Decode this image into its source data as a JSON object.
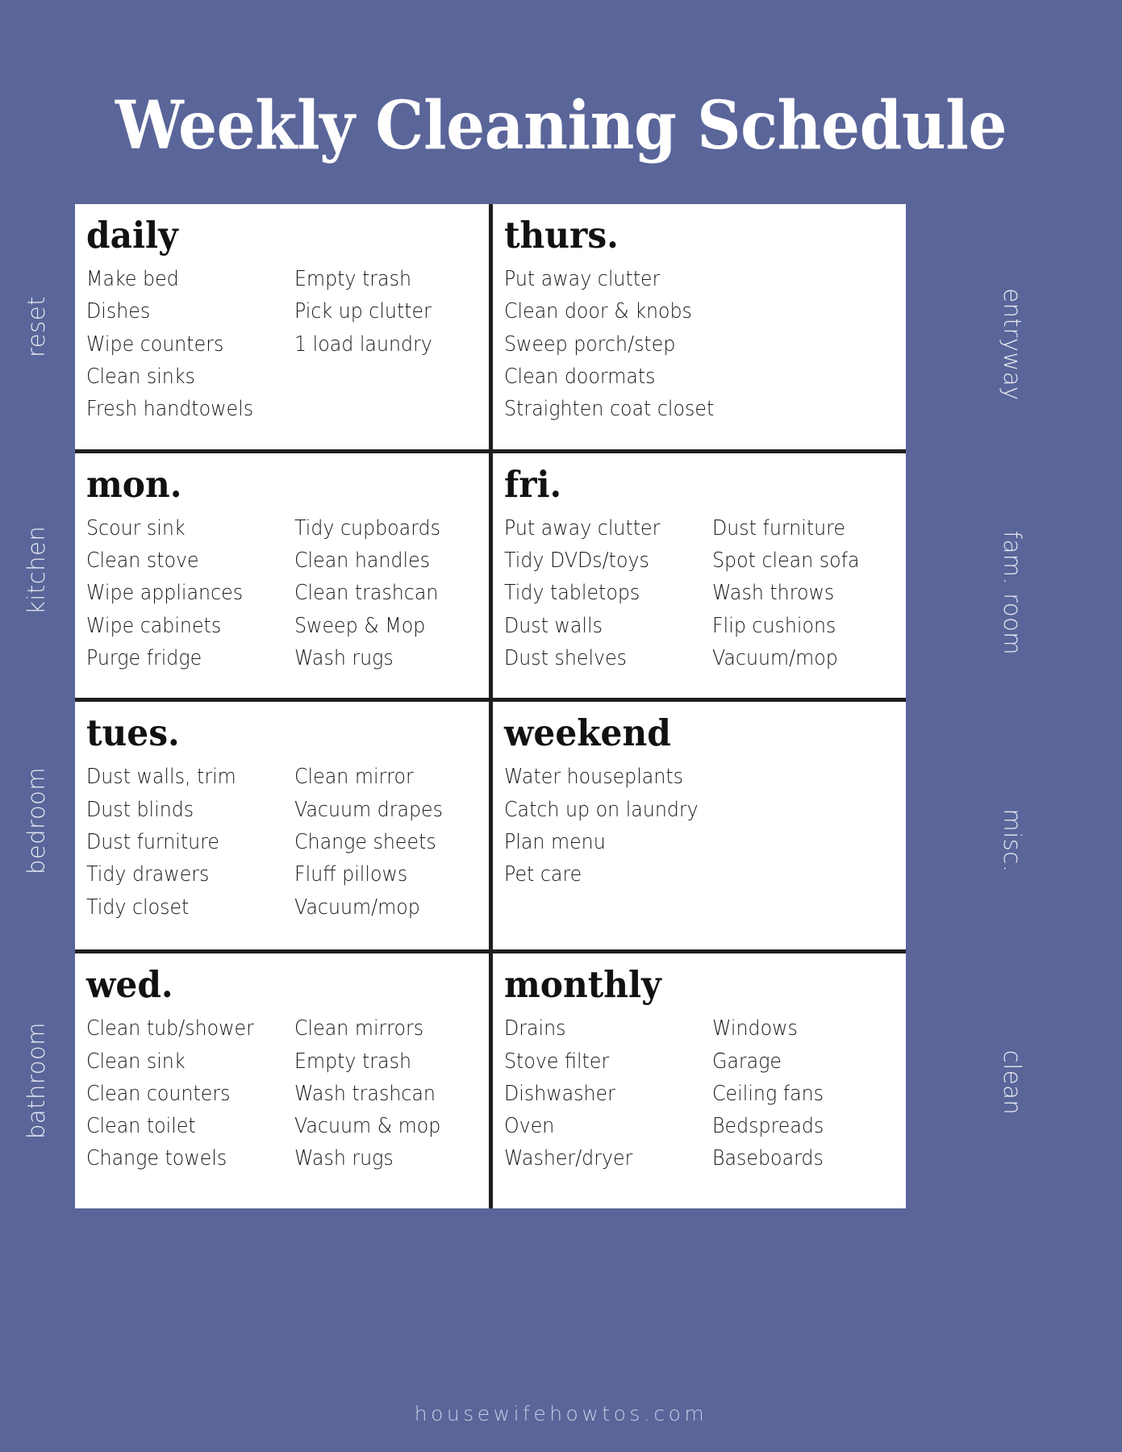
{
  "meta": {
    "background_color": "#5a6599",
    "card_background": "#ffffff",
    "divider_color": "#1f1f1f",
    "heading_color": "#111111",
    "side_label_color": "#e8eaf3"
  },
  "title": "Weekly Cleaning Schedule",
  "footer": "housewifehowtos.com",
  "side_labels": {
    "left": [
      {
        "text": "reset"
      },
      {
        "text": "kitchen"
      },
      {
        "text": "bedroom"
      },
      {
        "text": "bathroom"
      }
    ],
    "right": [
      {
        "text": "entryway"
      },
      {
        "text": "fam. room"
      },
      {
        "text": "misc."
      },
      {
        "text": "clean"
      }
    ]
  },
  "cards": [
    {
      "id": "daily",
      "heading": "daily",
      "col1": [
        "Make bed",
        "Dishes",
        "Wipe counters",
        "Clean sinks",
        "Fresh handtowels"
      ],
      "col2": [
        "Empty trash",
        "Pick up clutter",
        "1 load laundry"
      ]
    },
    {
      "id": "thurs",
      "heading": "thurs.",
      "col1": [
        "Put away clutter",
        "Clean door & knobs",
        "Sweep porch/step",
        "Clean doormats",
        "Straighten coat closet"
      ],
      "col2": []
    },
    {
      "id": "mon",
      "heading": "mon.",
      "col1": [
        "Scour sink",
        "Clean stove",
        "Wipe appliances",
        "Wipe cabinets",
        "Purge fridge"
      ],
      "col2": [
        "Tidy cupboards",
        "Clean handles",
        "Clean trashcan",
        "Sweep & Mop",
        "Wash rugs"
      ]
    },
    {
      "id": "fri",
      "heading": "fri.",
      "col1": [
        "Put away clutter",
        "Tidy DVDs/toys",
        "Tidy tabletops",
        "Dust walls",
        "Dust shelves"
      ],
      "col2": [
        "Dust furniture",
        "Spot clean sofa",
        "Wash throws",
        "Flip cushions",
        "Vacuum/mop"
      ]
    },
    {
      "id": "tues",
      "heading": "tues.",
      "col1": [
        "Dust walls, trim",
        "Dust blinds",
        "Dust furniture",
        "Tidy drawers",
        "Tidy closet"
      ],
      "col2": [
        "Clean mirror",
        "Vacuum drapes",
        "Change sheets",
        "Fluff pillows",
        "Vacuum/mop"
      ]
    },
    {
      "id": "weekend",
      "heading": "weekend",
      "col1": [
        "Water houseplants",
        "Catch up on laundry",
        "Plan menu",
        "Pet care"
      ],
      "col2": []
    },
    {
      "id": "wed",
      "heading": "wed.",
      "col1": [
        "Clean tub/shower",
        "Clean sink",
        "Clean counters",
        "Clean toilet",
        "Change towels"
      ],
      "col2": [
        "Clean mirrors",
        "Empty trash",
        "Wash trashcan",
        "Vacuum & mop",
        "Wash rugs"
      ]
    },
    {
      "id": "monthly",
      "heading": "monthly",
      "col1": [
        "Drains",
        "Stove filter",
        "Dishwasher",
        "Oven",
        "Washer/dryer"
      ],
      "col2": [
        "Windows",
        "Garage",
        "Ceiling fans",
        "Bedspreads",
        "Baseboards"
      ]
    }
  ]
}
